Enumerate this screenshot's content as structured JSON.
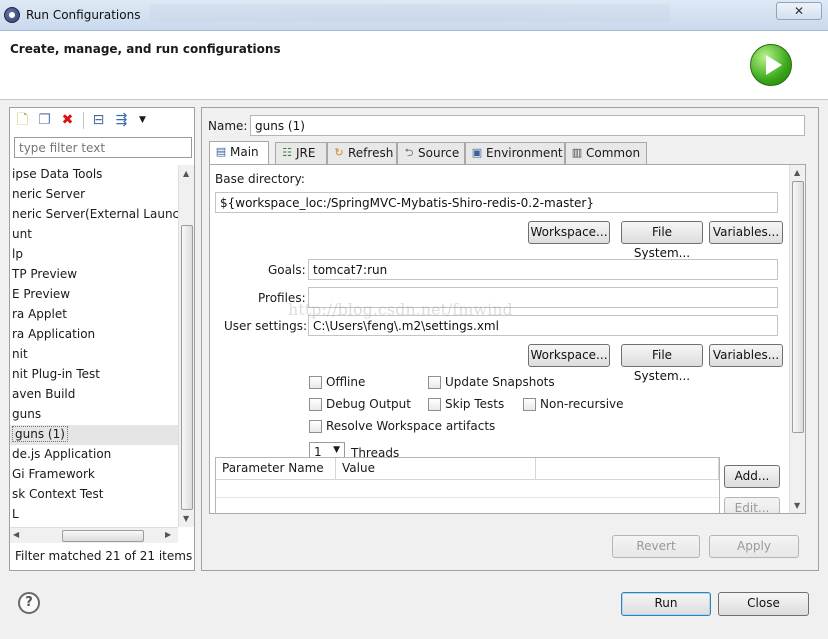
{
  "window": {
    "title": "Run Configurations",
    "close_symbol": "✕"
  },
  "banner": {
    "heading": "Create, manage, and run configurations"
  },
  "left": {
    "filter_placeholder": "type filter text",
    "tree_items": [
      "ipse Data Tools",
      "neric Server",
      "neric Server(External Launch",
      "unt",
      "lp",
      "TP Preview",
      "E Preview",
      "ra Applet",
      "ra Application",
      "nit",
      "nit Plug-in Test",
      "aven Build",
      "guns",
      "guns (1)",
      "de.js Application",
      "Gi Framework",
      "sk Context Test",
      "L"
    ],
    "selected_index": 13,
    "filter_status": "Filter matched 21 of 21 items"
  },
  "right": {
    "name_label": "Name:",
    "name_value": "guns (1)",
    "tabs": [
      {
        "label": "Main",
        "icon": "main-tab-icon"
      },
      {
        "label": "JRE",
        "icon": "jre-icon"
      },
      {
        "label": "Refresh",
        "icon": "refresh-icon"
      },
      {
        "label": "Source",
        "icon": "source-icon"
      },
      {
        "label": "Environment",
        "icon": "environment-icon"
      },
      {
        "label": "Common",
        "icon": "common-icon"
      }
    ],
    "base_dir_label": "Base directory:",
    "base_dir_value": "${workspace_loc:/SpringMVC-Mybatis-Shiro-redis-0.2-master}",
    "workspace_btn": "Workspace...",
    "filesystem_btn": "File System...",
    "variables_btn": "Variables...",
    "goals_label": "Goals:",
    "goals_value": "tomcat7:run",
    "profiles_label": "Profiles:",
    "profiles_value": "",
    "user_settings_label": "User settings:",
    "user_settings_value": "C:\\Users\\feng\\.m2\\settings.xml",
    "watermark": "http://blog.csdn.net/fmwind",
    "checkboxes": {
      "offline": "Offline",
      "update_snapshots": "Update Snapshots",
      "debug_output": "Debug Output",
      "skip_tests": "Skip Tests",
      "non_recursive": "Non-recursive",
      "resolve_workspace": "Resolve Workspace artifacts"
    },
    "threads_value": "1",
    "threads_label": "Threads",
    "param_headers": [
      "Parameter Name",
      "Value"
    ],
    "add_btn": "Add...",
    "edit_btn": "Edit...",
    "revert_btn": "Revert",
    "apply_btn": "Apply"
  },
  "footer": {
    "help_symbol": "?",
    "run_btn": "Run",
    "close_btn": "Close"
  }
}
